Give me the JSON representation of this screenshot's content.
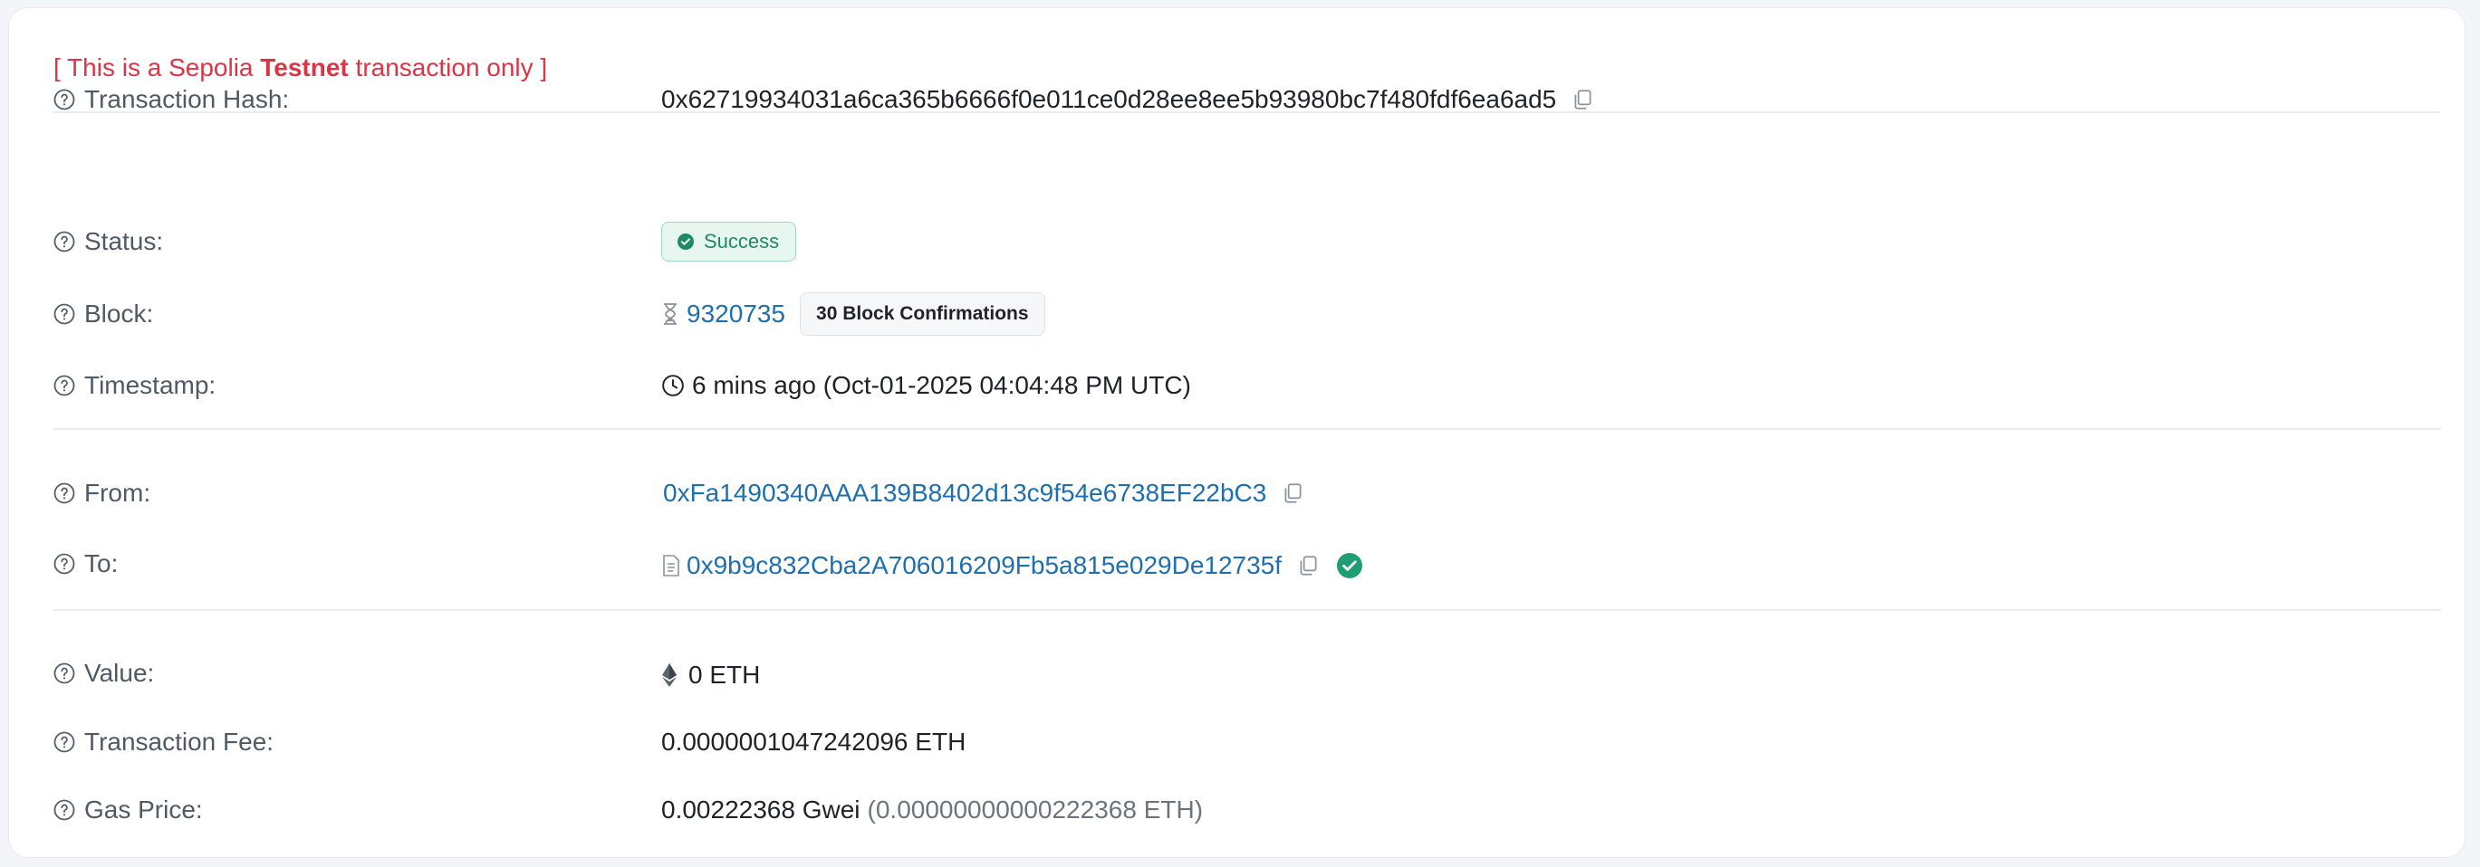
{
  "notice": {
    "prefix": "[ This is a Sepolia ",
    "bold": "Testnet",
    "suffix": " transaction only ]"
  },
  "rows": {
    "tx_hash": {
      "label": "Transaction Hash:",
      "value": "0x62719934031a6ca365b6666f0e011ce0d28ee8ee5b93980bc7f480fdf6ea6ad5"
    },
    "status": {
      "label": "Status:",
      "value": "Success"
    },
    "block": {
      "label": "Block:",
      "number": "9320735",
      "confirmations": "30 Block Confirmations"
    },
    "timestamp": {
      "label": "Timestamp:",
      "value": "6 mins ago (Oct-01-2025 04:04:48 PM UTC)"
    },
    "from": {
      "label": "From:",
      "value": "0xFa1490340AAA139B8402d13c9f54e6738EF22bC3"
    },
    "to": {
      "label": "To:",
      "value": "0x9b9c832Cba2A706016209Fb5a815e029De12735f"
    },
    "value": {
      "label": "Value:",
      "value": "0 ETH"
    },
    "tx_fee": {
      "label": "Transaction Fee:",
      "value": "0.0000001047242096 ETH"
    },
    "gas_price": {
      "label": "Gas Price:",
      "value": "0.00222368 Gwei",
      "secondary": "(0.00000000000222368 ETH)"
    }
  },
  "icons": {
    "help": "question-circle-icon",
    "copy": "copy-icon",
    "success": "check-circle-icon",
    "block": "hourglass-icon",
    "time": "clock-icon",
    "contract": "document-icon",
    "verified": "verified-check-icon",
    "eth": "ethereum-icon"
  },
  "colors": {
    "notice": "#dc3545",
    "link": "#1e6fb0",
    "success_text": "#1f8a64",
    "success_bg": "#e8f6f0",
    "label": "#4f5a64"
  }
}
